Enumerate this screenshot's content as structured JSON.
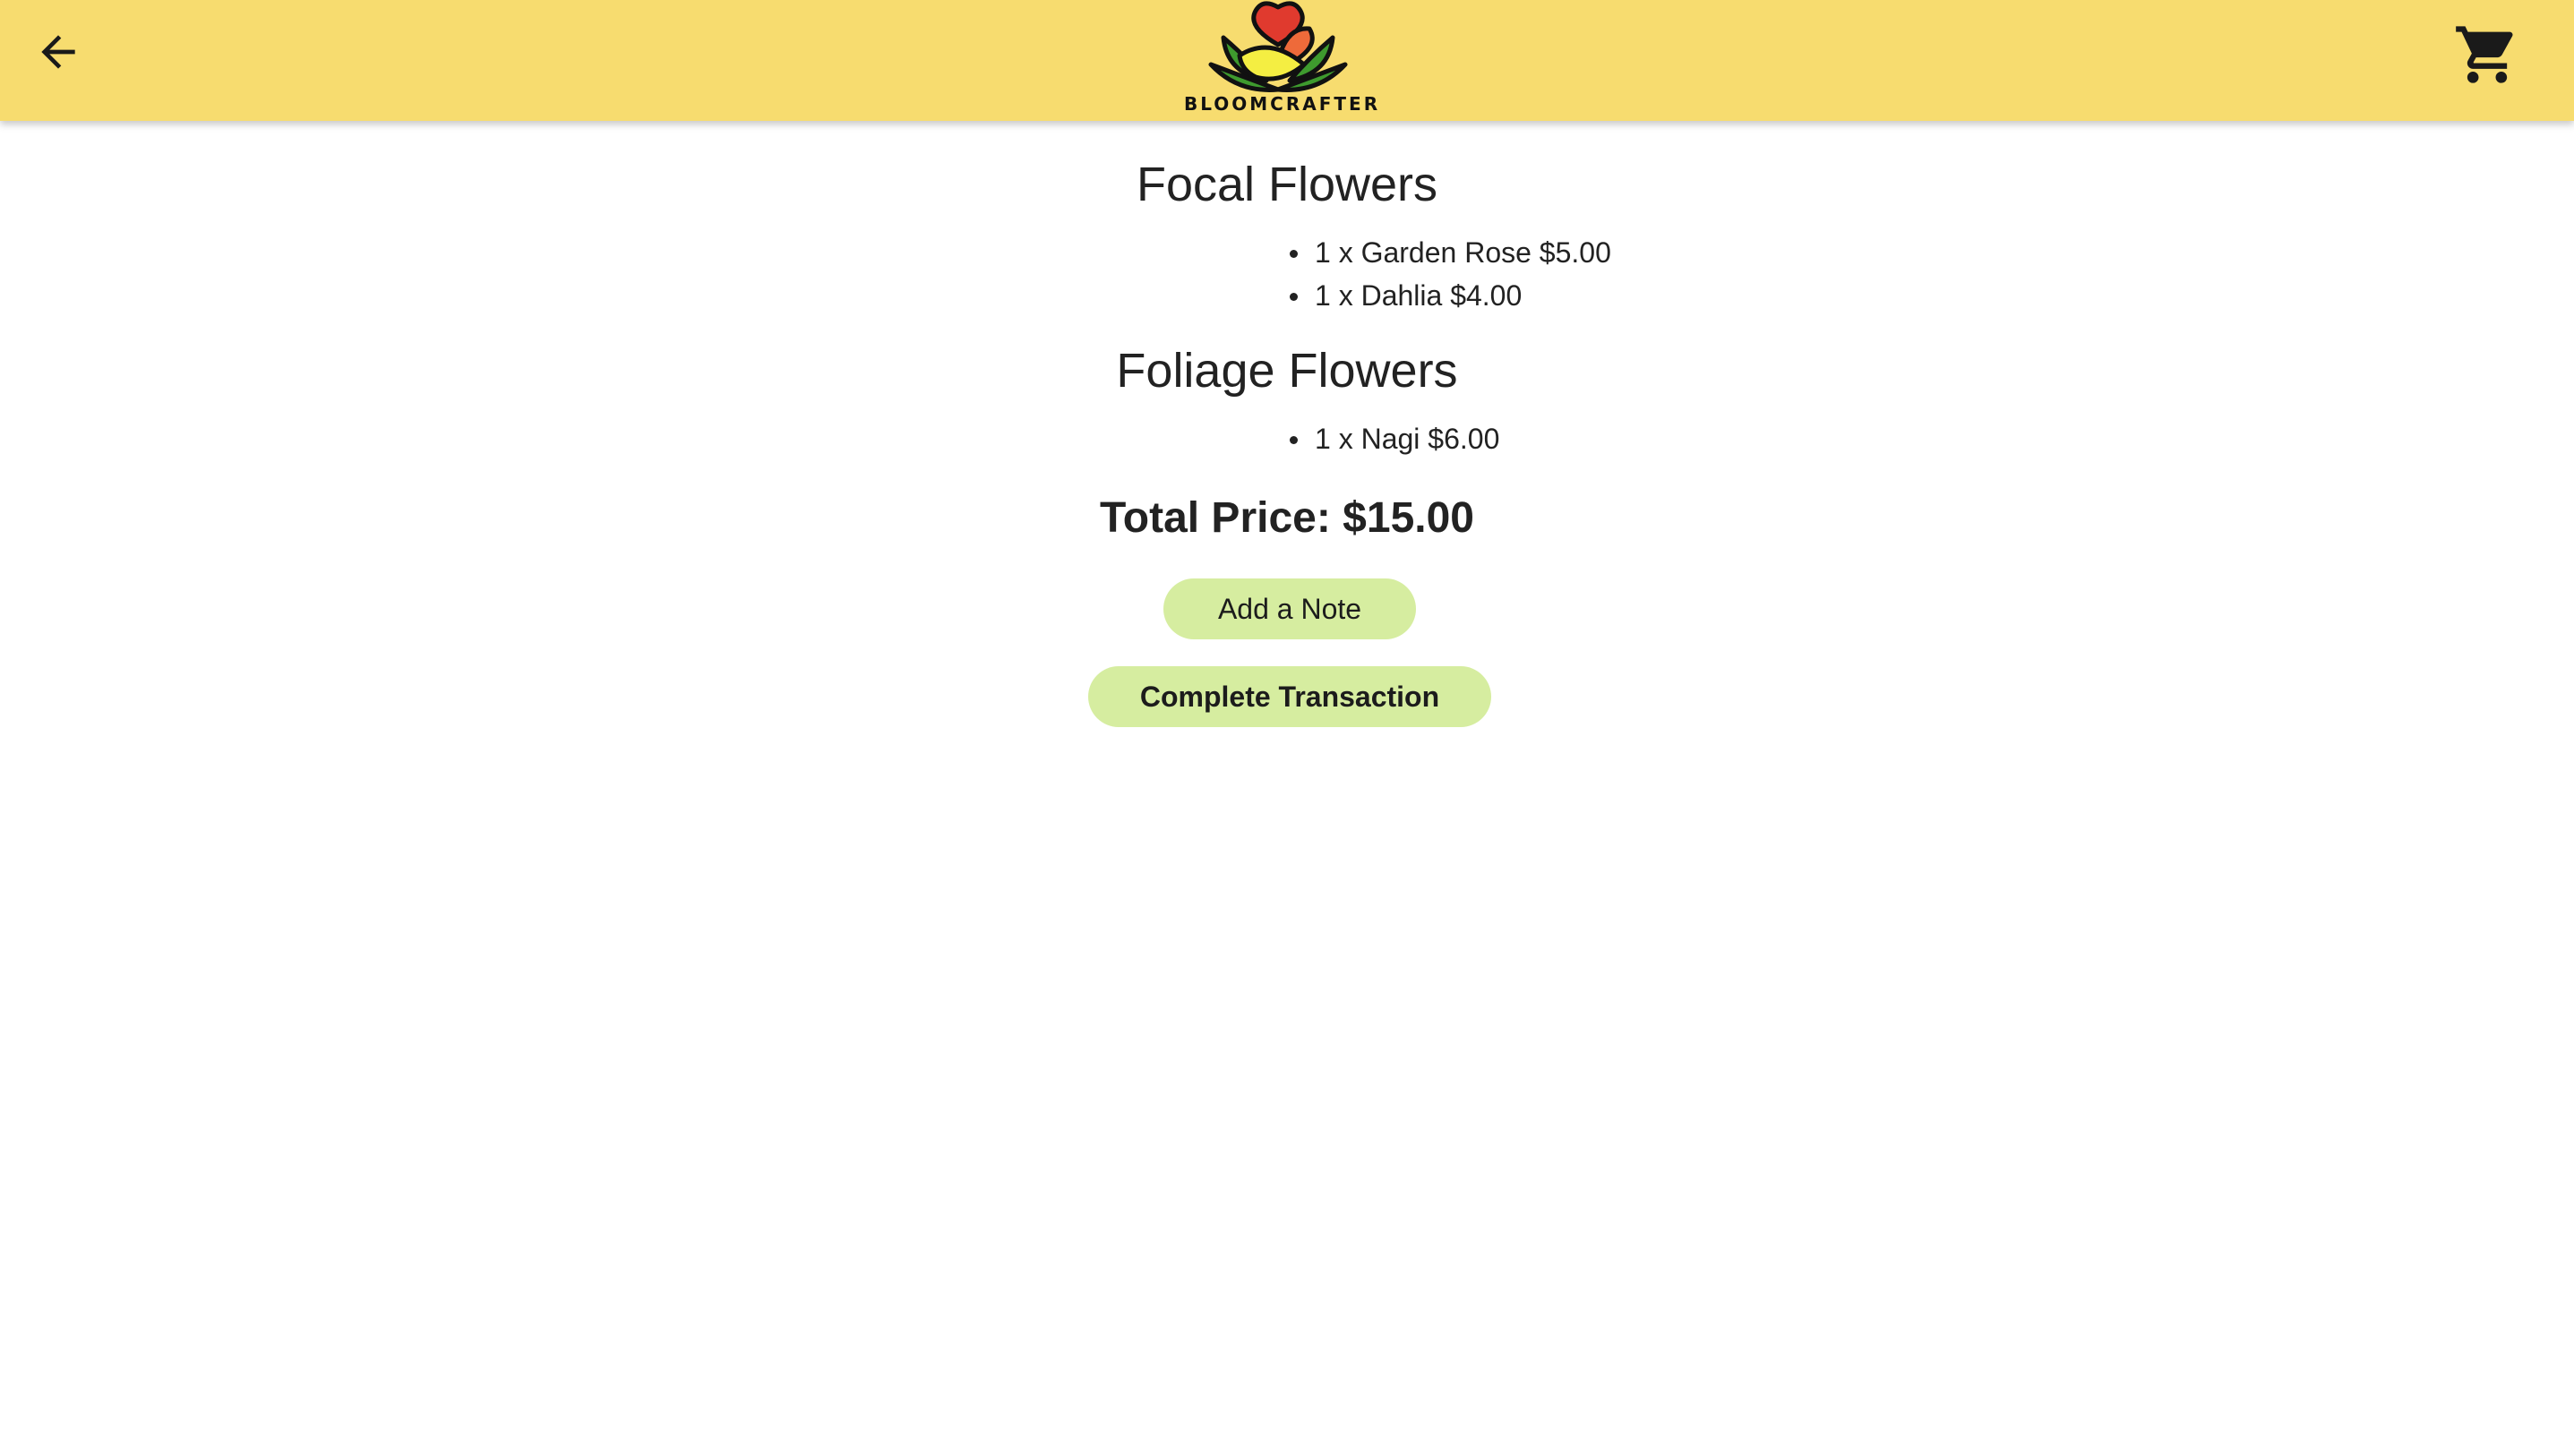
{
  "header": {
    "brand": "BLOOMCRAFTER",
    "back_icon": "arrow-left-icon",
    "cart_icon": "shopping-cart-icon",
    "background": "#F7DC6F"
  },
  "sections": [
    {
      "title": "Focal Flowers",
      "items": [
        "1 x Garden Rose $5.00",
        "1 x Dahlia $4.00"
      ]
    },
    {
      "title": "Foliage Flowers",
      "items": [
        "1 x Nagi $6.00"
      ]
    }
  ],
  "total": "Total Price: $15.00",
  "buttons": {
    "add_note": "Add a Note",
    "complete": "Complete Transaction",
    "color": "#D6EDA0"
  }
}
